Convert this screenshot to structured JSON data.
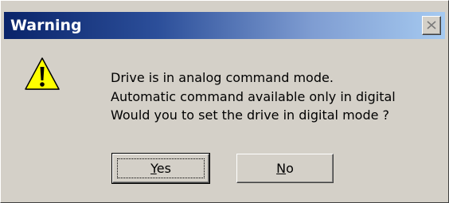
{
  "window": {
    "title": "Warning",
    "close_glyph": "✕"
  },
  "icon": {
    "name": "warning-icon",
    "fill": "#ffff00",
    "glyph": "!"
  },
  "message": {
    "lines": [
      "Drive is in analog command mode.",
      "Automatic command available only in digital",
      "Would you to set the drive in digital mode ?"
    ]
  },
  "buttons": {
    "yes": {
      "label": "Yes",
      "mnemonic": "Y",
      "rest": "es"
    },
    "no": {
      "label": "No",
      "mnemonic": "N",
      "rest": "o"
    }
  },
  "colors": {
    "title_start": "#0a246a",
    "title_end": "#a6caf0",
    "face": "#d4d0c8"
  }
}
